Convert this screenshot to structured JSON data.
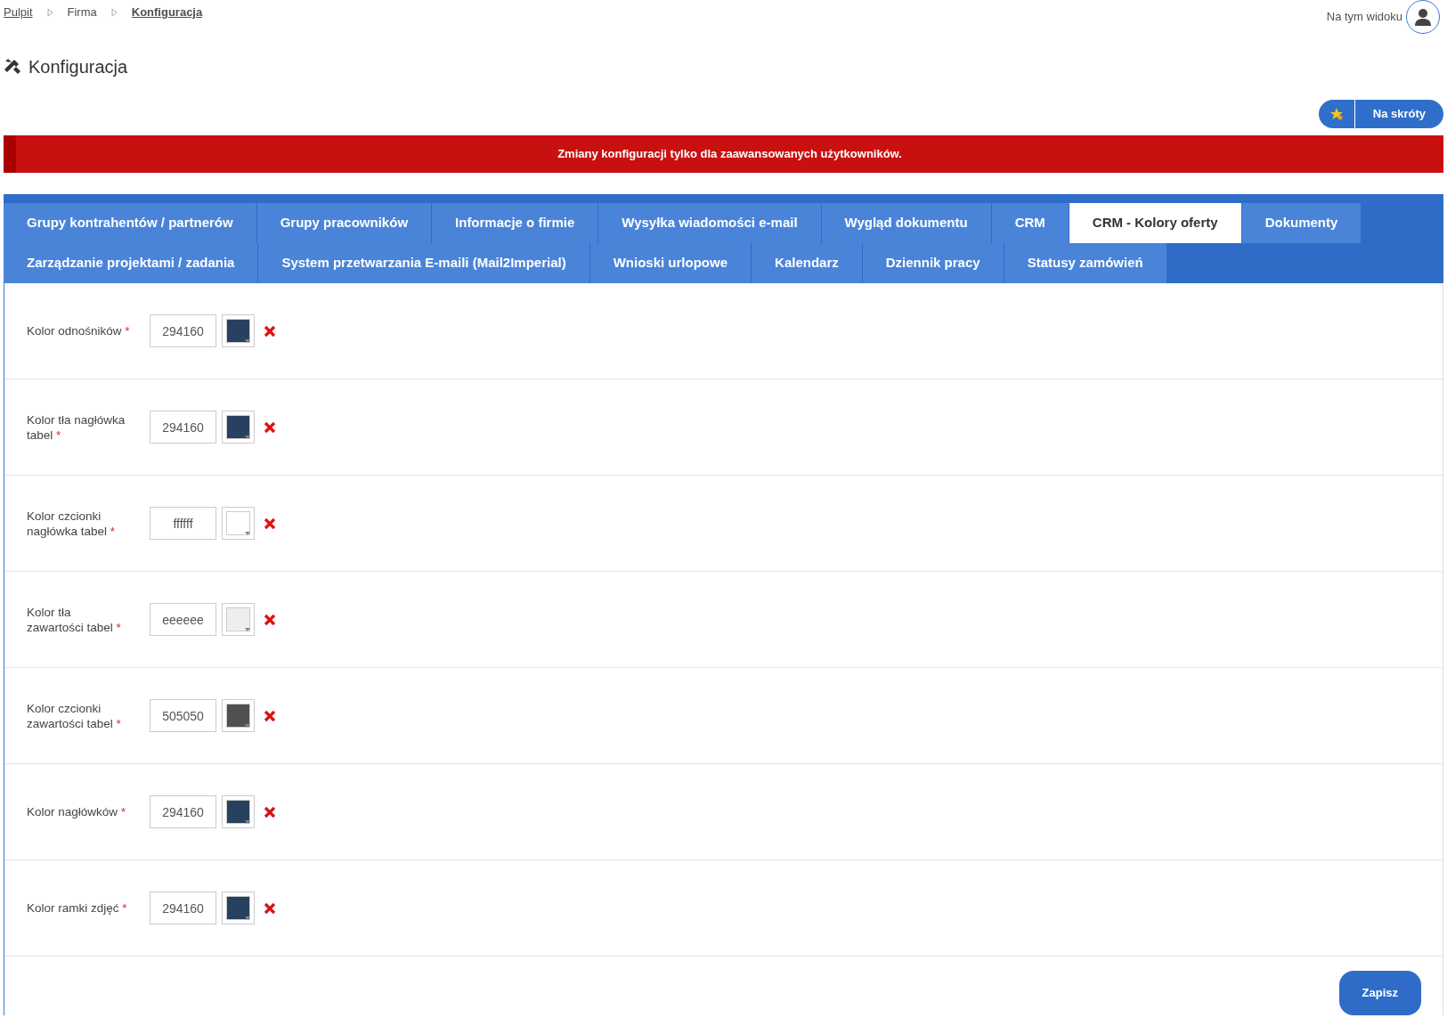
{
  "breadcrumb": [
    {
      "label": "Pulpit",
      "link": true,
      "current": false
    },
    {
      "label": "Firma",
      "link": false,
      "current": false
    },
    {
      "label": "Konfiguracja",
      "link": true,
      "current": true
    }
  ],
  "view_label": "Na tym widoku",
  "title": "Konfiguracja",
  "shortcut_button": "Na skróty",
  "alert": "Zmiany konfiguracji tylko dla zaawansowanych użytkowników.",
  "tab_rows": [
    [
      {
        "label": "Grupy kontrahentów / partnerów",
        "selected": false
      },
      {
        "label": "Grupy pracowników",
        "selected": false
      },
      {
        "label": "Informacje o firmie",
        "selected": false
      },
      {
        "label": "Wysyłka wiadomości e-mail",
        "selected": false
      },
      {
        "label": "Wygląd dokumentu",
        "selected": false
      },
      {
        "label": "CRM",
        "selected": false
      },
      {
        "label": "CRM - Kolory oferty",
        "selected": true
      },
      {
        "label": "Dokumenty",
        "selected": false
      }
    ],
    [
      {
        "label": "Zarządzanie projektami / zadania",
        "selected": false
      },
      {
        "label": "System przetwarzania E-maili (Mail2Imperial)",
        "selected": false
      },
      {
        "label": "Wnioski urlopowe",
        "selected": false
      },
      {
        "label": "Kalendarz",
        "selected": false
      },
      {
        "label": "Dziennik pracy",
        "selected": false
      },
      {
        "label": "Statusy zamówień",
        "selected": false
      }
    ]
  ],
  "fields": [
    {
      "label": "Kolor odnośników",
      "required_mark": "*",
      "value": "294160"
    },
    {
      "label": "Kolor tła nagłówka tabel",
      "required_mark": "*",
      "value": "294160"
    },
    {
      "label": "Kolor czcionki nagłówka tabel",
      "required_mark": "*",
      "value": "ffffff"
    },
    {
      "label": "Kolor tła zawartości tabel",
      "required_mark": "*",
      "value": "eeeeee"
    },
    {
      "label": "Kolor czcionki zawartości tabel",
      "required_mark": "*",
      "value": "505050"
    },
    {
      "label": "Kolor nagłówków",
      "required_mark": "*",
      "value": "294160"
    },
    {
      "label": "Kolor ramki zdjęć",
      "required_mark": "*",
      "value": "294160"
    }
  ],
  "save_button": "Zapisz"
}
